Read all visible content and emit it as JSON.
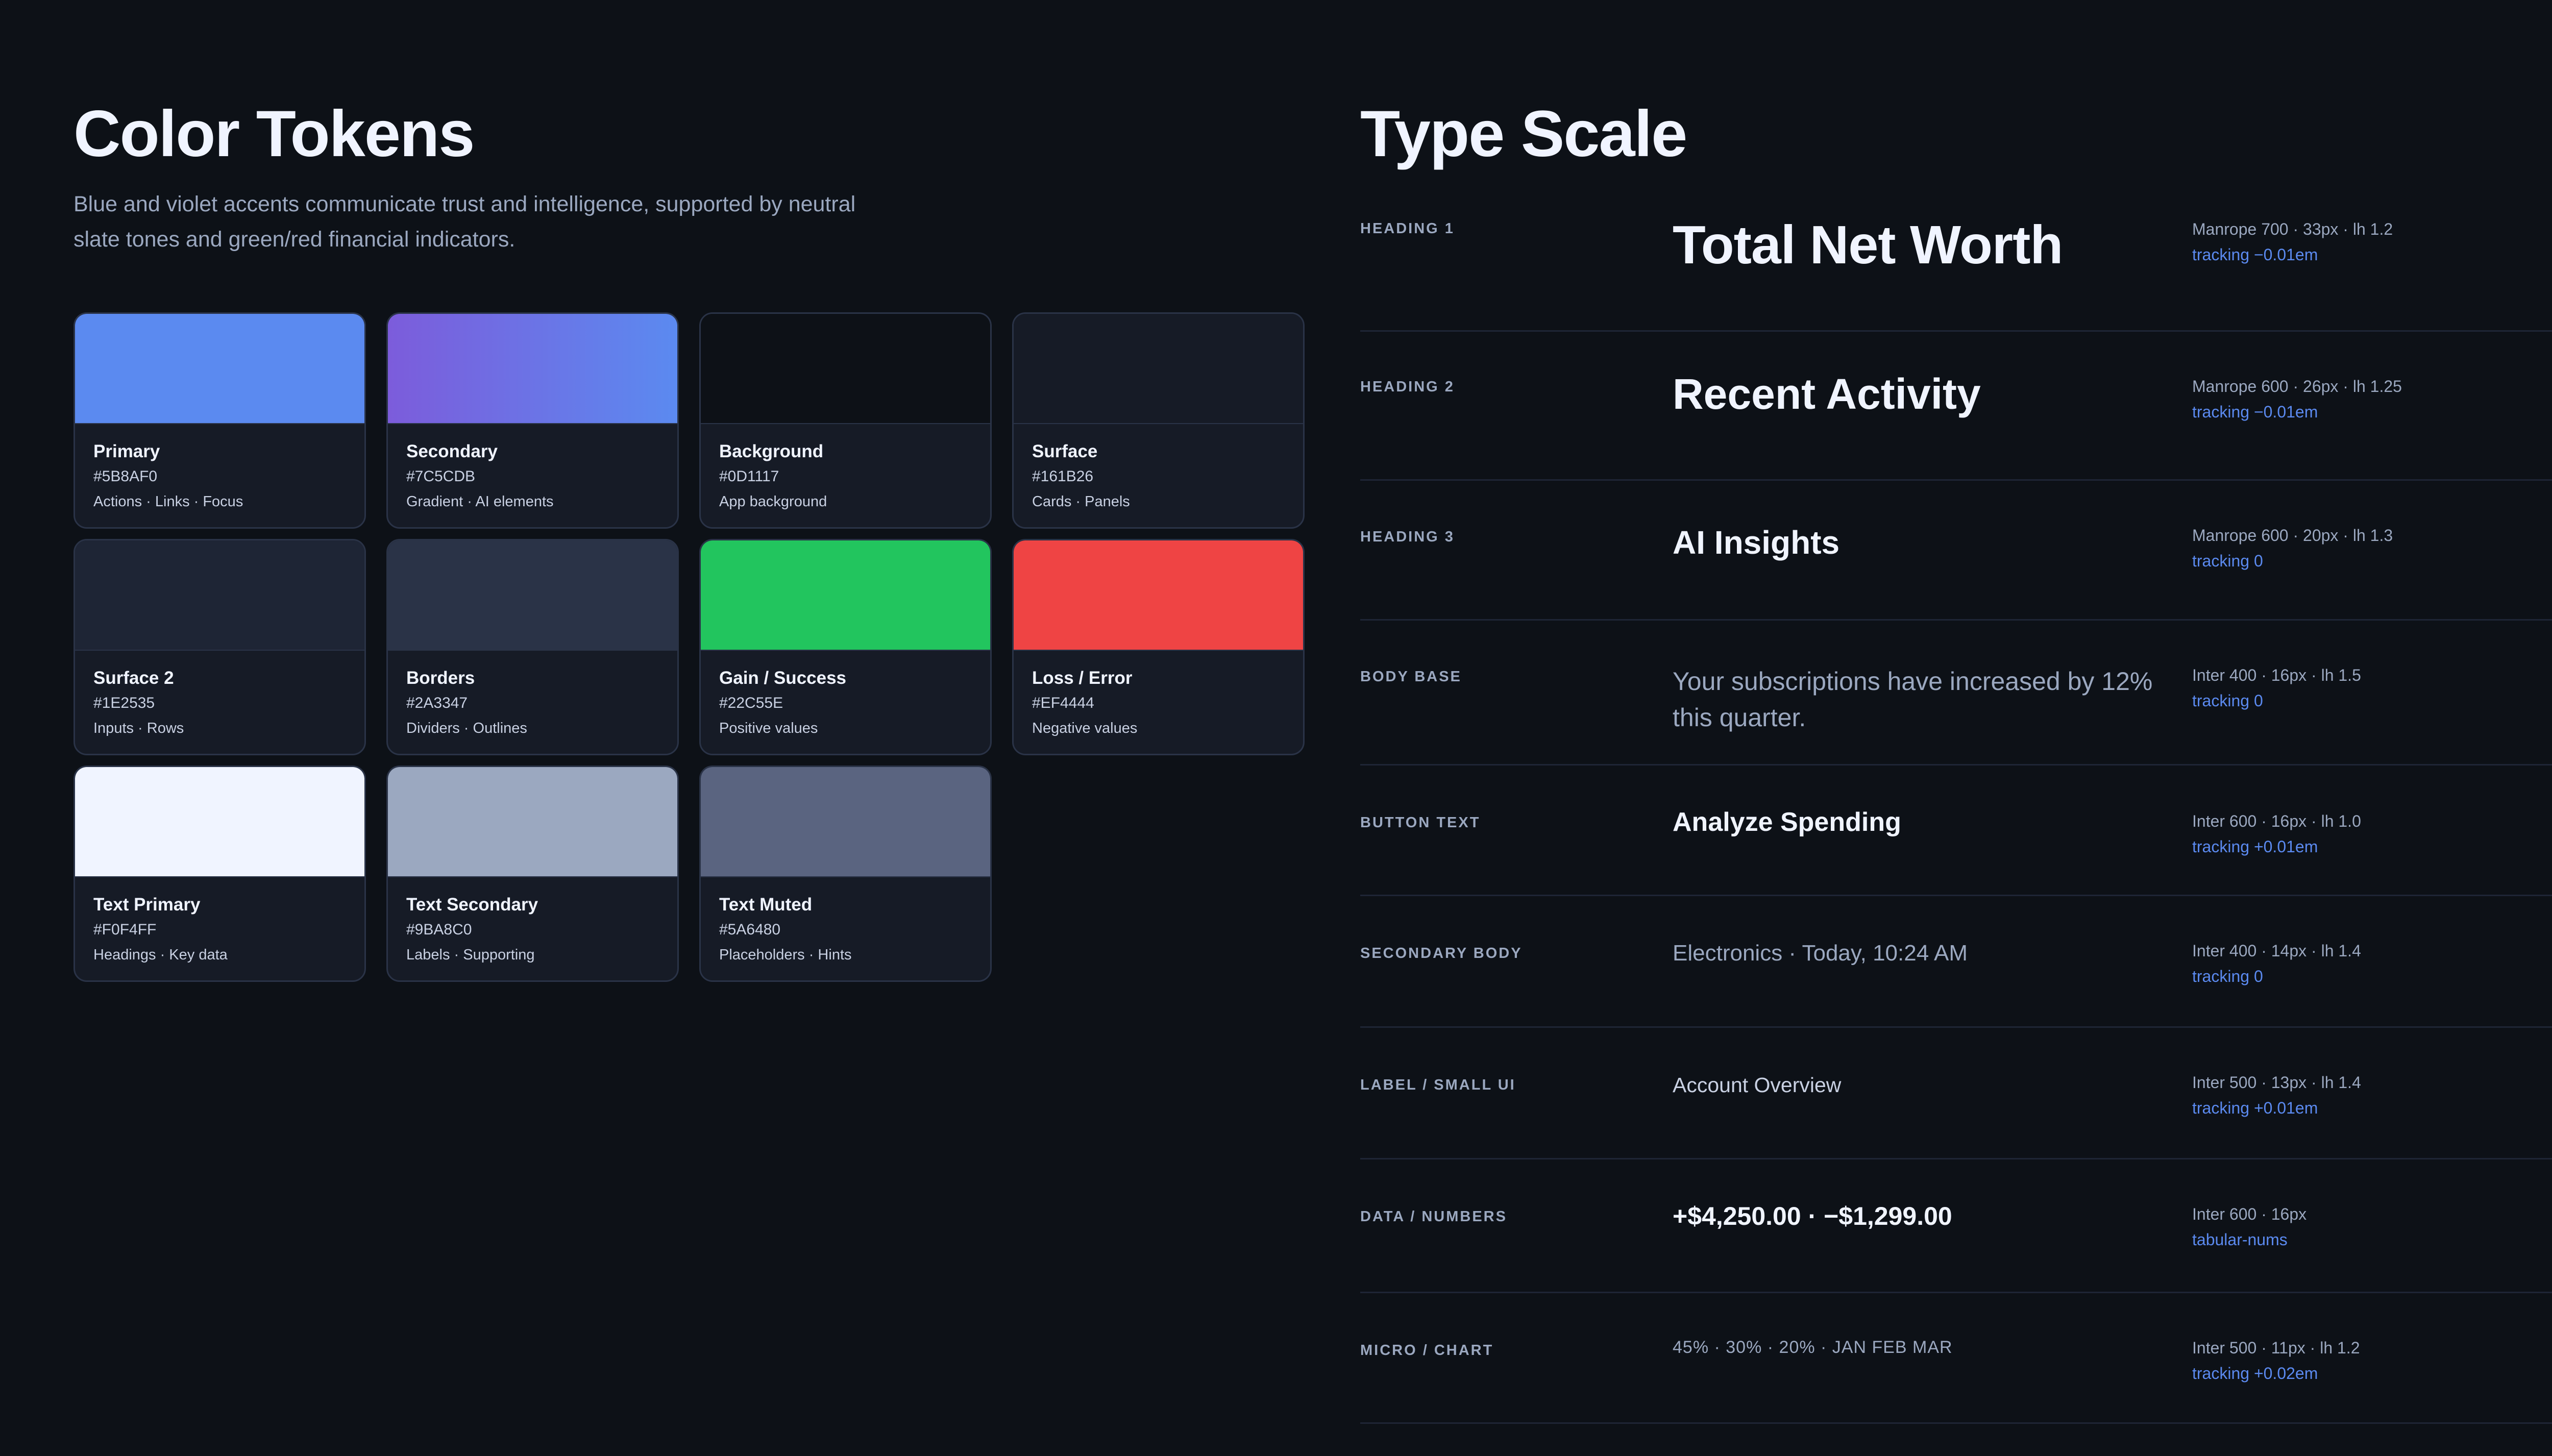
{
  "color_tokens": {
    "title": "Color Tokens",
    "description": "Blue and violet accents communicate trust and intelligence, supported by neutral slate tones and green/red financial indicators.",
    "tokens": [
      {
        "name": "Primary",
        "hex": "#5B8AF0",
        "usage": "Actions · Links · Focus",
        "swatch": "#5B8AF0"
      },
      {
        "name": "Secondary",
        "hex": "#7C5CDB",
        "usage": "Gradient · AI elements",
        "swatch": "linear-gradient(90deg, #7C5CDB, #5B8AF0)"
      },
      {
        "name": "Background",
        "hex": "#0D1117",
        "usage": "App background",
        "swatch": "#0D1117"
      },
      {
        "name": "Surface",
        "hex": "#161B26",
        "usage": "Cards · Panels",
        "swatch": "#161B26"
      },
      {
        "name": "Surface 2",
        "hex": "#1E2535",
        "usage": "Inputs · Rows",
        "swatch": "#1E2535"
      },
      {
        "name": "Borders",
        "hex": "#2A3347",
        "usage": "Dividers · Outlines",
        "swatch": "#2A3347"
      },
      {
        "name": "Gain / Success",
        "hex": "#22C55E",
        "usage": "Positive values",
        "swatch": "#22C55E"
      },
      {
        "name": "Loss / Error",
        "hex": "#EF4444",
        "usage": "Negative values",
        "swatch": "#EF4444"
      },
      {
        "name": "Text Primary",
        "hex": "#F0F4FF",
        "usage": "Headings · Key data",
        "swatch": "#F0F4FF"
      },
      {
        "name": "Text Secondary",
        "hex": "#9BA8C0",
        "usage": "Labels · Supporting",
        "swatch": "#9BA8C0"
      },
      {
        "name": "Text Muted",
        "hex": "#5A6480",
        "usage": "Placeholders · Hints",
        "swatch": "#5A6480"
      }
    ]
  },
  "type_scale": {
    "title": "Type Scale",
    "rows": [
      {
        "label": "HEADING 1",
        "sample": "Total Net Worth",
        "spec": "Manrope 700 · 33px · lh 1.2",
        "tracking": "tracking −0.01em"
      },
      {
        "label": "HEADING 2",
        "sample": "Recent Activity",
        "spec": "Manrope 600 · 26px · lh 1.25",
        "tracking": "tracking −0.01em"
      },
      {
        "label": "HEADING 3",
        "sample": "AI Insights",
        "spec": "Manrope 600 · 20px · lh 1.3",
        "tracking": "tracking 0"
      },
      {
        "label": "BODY BASE",
        "sample": "Your subscriptions have increased by 12% this quarter.",
        "spec": "Inter 400 · 16px · lh 1.5",
        "tracking": "tracking 0"
      },
      {
        "label": "BUTTON TEXT",
        "sample": "Analyze Spending",
        "spec": "Inter 600 · 16px · lh 1.0",
        "tracking": "tracking +0.01em"
      },
      {
        "label": "SECONDARY BODY",
        "sample": "Electronics · Today, 10:24 AM",
        "spec": "Inter 400 · 14px · lh 1.4",
        "tracking": "tracking 0"
      },
      {
        "label": "LABEL / SMALL UI",
        "sample": "Account Overview",
        "spec": "Inter 500 · 13px · lh 1.4",
        "tracking": "tracking +0.01em"
      },
      {
        "label": "DATA / NUMBERS",
        "sample": "+$4,250.00 · −$1,299.00",
        "spec": "Inter 600 · 16px",
        "tracking": "tabular-nums"
      },
      {
        "label": "MICRO / CHART",
        "sample": "45% · 30% · 20% · JAN FEB MAR",
        "spec": "Inter 500 · 11px · lh 1.2",
        "tracking": "tracking +0.02em"
      }
    ]
  }
}
